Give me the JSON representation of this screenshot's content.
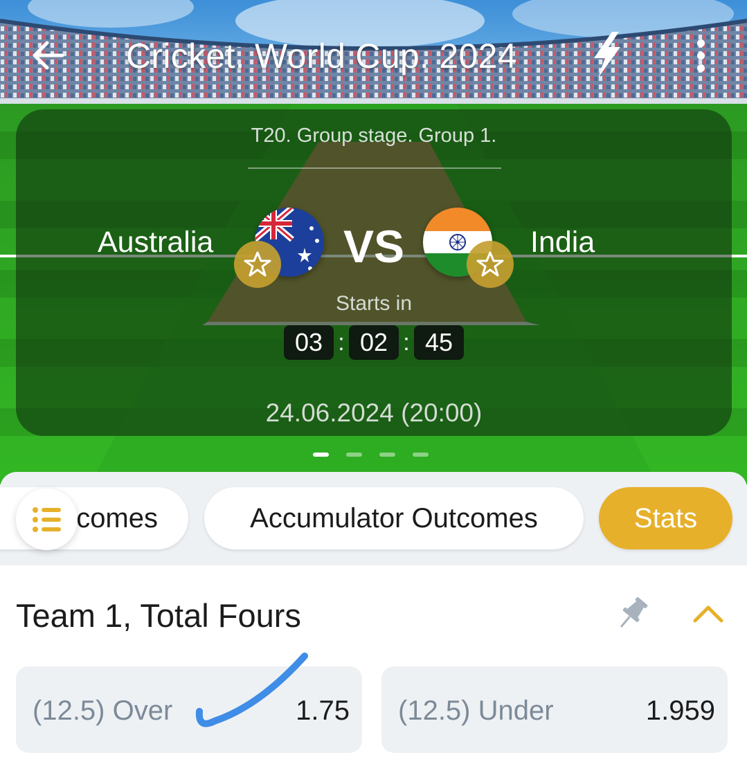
{
  "header": {
    "title": "Cricket. World Cup. 2024"
  },
  "match": {
    "stage": "T20. Group stage. Group 1.",
    "team1": {
      "name": "Australia",
      "flag": "australia-flag"
    },
    "team2": {
      "name": "India",
      "flag": "india-flag"
    },
    "vs": "VS",
    "starts_in_label": "Starts in",
    "countdown": {
      "hours": "03",
      "minutes": "02",
      "seconds": "45",
      "separator": ":"
    },
    "datetime": "24.06.2024 (20:00)"
  },
  "carousel": {
    "pages": 4,
    "active_index": 0
  },
  "tabs": [
    {
      "label": "Outcomes",
      "visible_label": "comes",
      "active": false
    },
    {
      "label": "Accumulator Outcomes",
      "active": false
    },
    {
      "label": "Stats",
      "active": true
    }
  ],
  "market": {
    "title": "Team 1, Total Fours",
    "odds": [
      {
        "label": "(12.5) Over",
        "value": "1.75",
        "marked": true
      },
      {
        "label": "(12.5) Under",
        "value": "1.959",
        "marked": false
      }
    ]
  },
  "colors": {
    "accent": "#e6b02a",
    "favorite": "#c4a030",
    "grass": "#2db51e",
    "checkmark": "#3f8de6",
    "odd_label": "#7c8a98"
  },
  "icons": [
    "back-arrow-icon",
    "lightning-icon",
    "more-vertical-icon",
    "star-icon",
    "list-icon",
    "pin-icon",
    "chevron-up-icon",
    "checkmark-annotation"
  ]
}
